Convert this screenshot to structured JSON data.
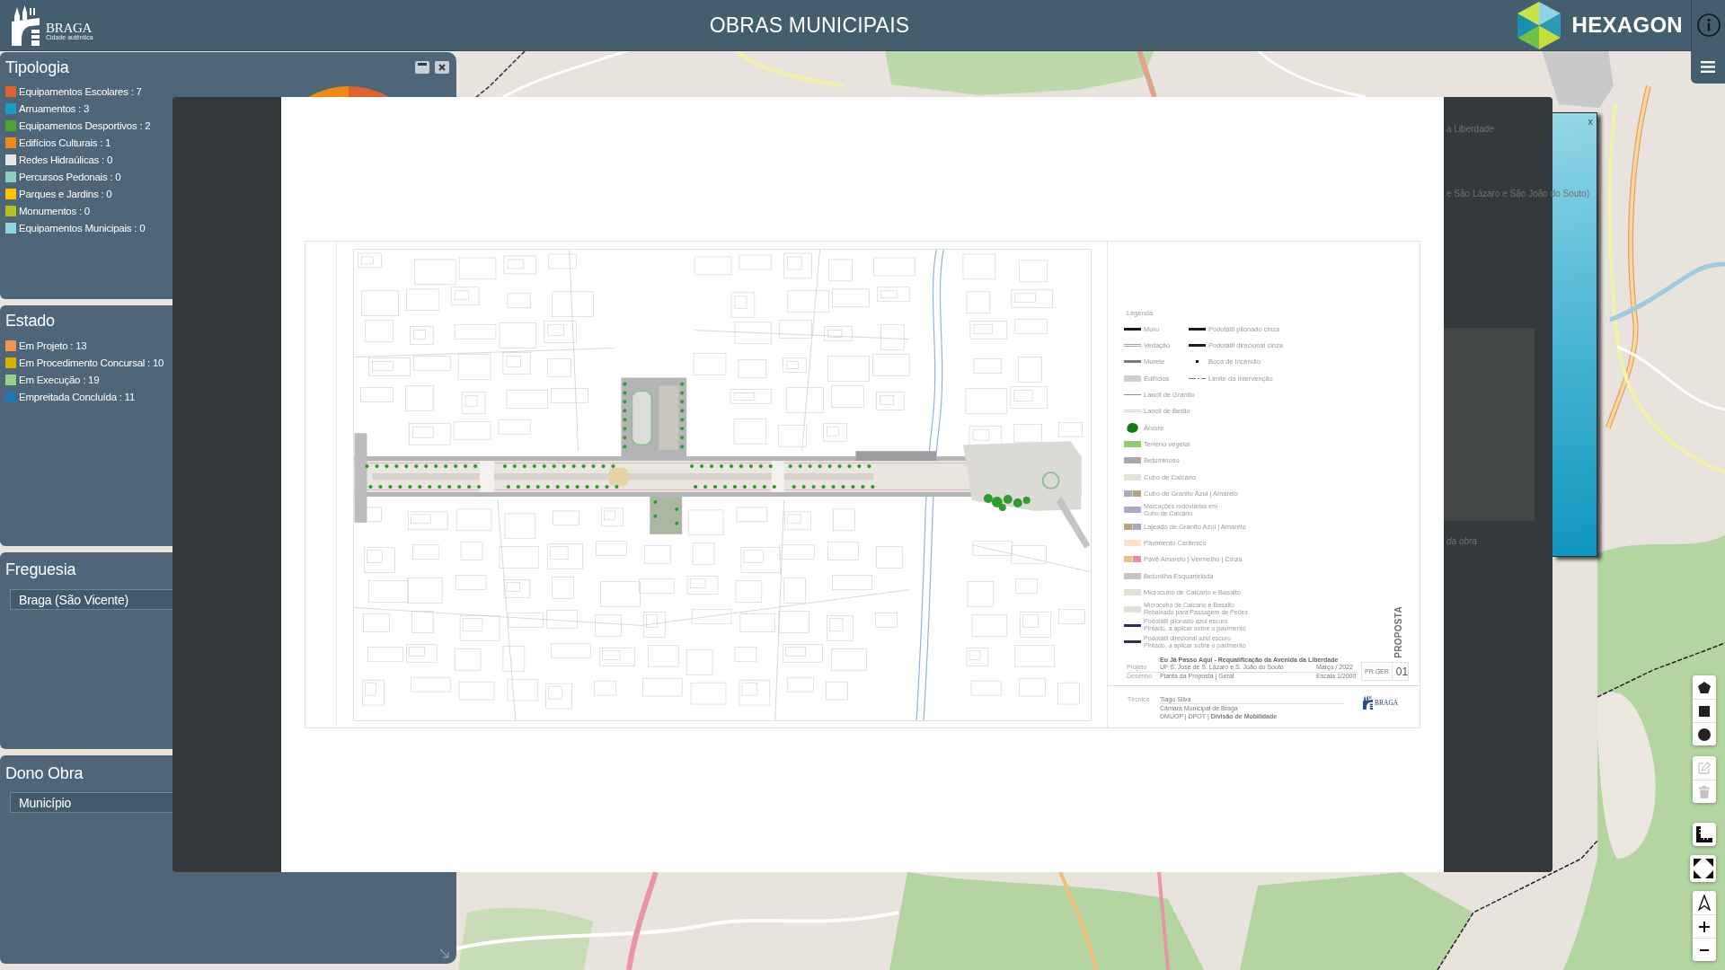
{
  "header": {
    "logo_name": "BRAGA",
    "logo_tagline": "Cidade autêntica",
    "title": "OBRAS MUNICIPAIS",
    "partner_name": "HEXAGON"
  },
  "filter_panels": [
    {
      "kind": "legend",
      "title": "Tipologia",
      "items": [
        {
          "label": "Equipamentos Escolares : 7",
          "color": "#e0622f"
        },
        {
          "label": "Arruamentos : 3",
          "color": "#1b9cc6"
        },
        {
          "label": "Equipamentos Desportivos : 2",
          "color": "#4fa330"
        },
        {
          "label": "Edifícios Culturais : 1",
          "color": "#f08a14"
        },
        {
          "label": "Redes Hidraúlicas : 0",
          "color": "#e6e6e6"
        },
        {
          "label": "Percursos Pedonais : 0",
          "color": "#8fcfc0"
        },
        {
          "label": "Parques e Jardins : 0",
          "color": "#f5c500"
        },
        {
          "label": "Monumentos : 0",
          "color": "#b6c21b"
        },
        {
          "label": "Equipamentos Municipais : 0",
          "color": "#8fd4e2"
        }
      ]
    },
    {
      "kind": "legend",
      "title": "Estado",
      "items": [
        {
          "label": "Em Projeto : 13",
          "color": "#f2964b"
        },
        {
          "label": "Em Procedimento Concursal : 10",
          "color": "#d6b300"
        },
        {
          "label": "Em Execução : 19",
          "color": "#99d18b"
        },
        {
          "label": "Empreitada Concluída : 11",
          "color": "#1f78b4"
        }
      ]
    },
    {
      "kind": "select",
      "title": "Freguesia",
      "value": "Braga (São Vicente)"
    },
    {
      "kind": "select",
      "title": "Dono Obra",
      "value": "Município"
    }
  ],
  "image_viewer": {
    "sheet": {
      "legend_title": "Legenda",
      "legend_columns": [
        {
          "items": [
            {
              "lines": [
                "Muro"
              ],
              "kind": "thick-line",
              "color": "#1a1a1a"
            },
            {
              "lines": [
                "Vedação"
              ],
              "kind": "double-line",
              "color": "#9a9a9a"
            },
            {
              "lines": [
                "Murete"
              ],
              "kind": "thick-line",
              "color": "#7a7a7a"
            },
            {
              "lines": [
                "Edifícios"
              ],
              "kind": "fill",
              "color": "#cfcfcf"
            },
            {
              "lines": [
                "Lancil de Granito"
              ],
              "kind": "thin-line",
              "color": "#8c8c8c"
            },
            {
              "lines": [
                "Lancil de Betão"
              ],
              "kind": "double-line",
              "color": "#cdcdcd"
            },
            {
              "lines": [
                "Árvore"
              ],
              "kind": "tree",
              "color": "#0e7d0e"
            },
            {
              "lines": [
                "Terreno vegetal"
              ],
              "kind": "fill",
              "color": "#8fcc74"
            },
            {
              "lines": [
                "Betuminoso"
              ],
              "kind": "fill",
              "color": "#a8a8aa"
            },
            {
              "lines": [
                "Cubo de Calcário"
              ],
              "kind": "fill",
              "color": "#e5e2da"
            },
            {
              "lines": [
                "Cubo de Granito Azul | Amarelo"
              ],
              "kind": "split-fill",
              "parts": [
                {
                  "color": "#a9abc3"
                },
                {
                  "color": "#b6a47c"
                }
              ]
            },
            {
              "lines": [
                "Marcações rodoviárias em",
                "Cubo de Calcário"
              ],
              "kind": "fill",
              "color": "#a9abc3"
            },
            {
              "lines": [
                "Lajeado de Granito Azul | Amarelo"
              ],
              "kind": "split-fill",
              "parts": [
                {
                  "color": "#b6a47c"
                },
                {
                  "color": "#a9abc3"
                }
              ]
            },
            {
              "lines": [
                "Pavimento Cerâmico"
              ],
              "kind": "fill",
              "color": "#fde1c9"
            },
            {
              "lines": [
                "Pavê Amarelo | Vermelho | Cinza"
              ],
              "kind": "split-fill",
              "parts": [
                {
                  "color": "#e8c27a"
                },
                {
                  "color": "#e48fa2"
                }
              ]
            },
            {
              "lines": [
                "Betonilha Esquartelada"
              ],
              "kind": "fill",
              "color": "#cac6bd"
            },
            {
              "lines": [
                "Microcubo de Calcário e Basalto"
              ],
              "kind": "fill",
              "color": "#e2dfd6"
            },
            {
              "lines": [
                "Microcubo de Calcário e Basalto",
                "Rebaixado para Passagem de Peões"
              ],
              "kind": "fill",
              "color": "#e2dfd6"
            },
            {
              "lines": [
                "Podotátil pilonado azul escuro",
                "Pintado, a aplicar sobre o pavimento"
              ],
              "kind": "thick-line",
              "color": "#2b2d66"
            },
            {
              "lines": [
                "Podotátil direcional azul escuro",
                "Pintado, a aplicar sobre o pavimento"
              ],
              "kind": "thick-line",
              "color": "#2b2d66"
            }
          ]
        },
        {
          "items": [
            {
              "lines": [
                "Podotátil pilonado cinza"
              ],
              "kind": "thick-line",
              "color": "#1c1c1c"
            },
            {
              "lines": [
                "Podotátil direcional cinza"
              ],
              "kind": "thick-line",
              "color": "#1c1c1c"
            },
            {
              "lines": [
                "Boca de Incêndio"
              ],
              "kind": "point",
              "color": "#1c1c1c"
            },
            {
              "lines": [
                "Limite da Intervenção"
              ],
              "kind": "dash-line",
              "color": "#777777"
            }
          ]
        }
      ],
      "stamp": "PROPOSTA",
      "project_title": "Eu Já Passo Aqui - Requalificação da Avenida da Liberdade",
      "title_rows": [
        {
          "label": "Projeto",
          "value": "UF S. José de S. Lázaro e S. João do Souto",
          "note": "Março / 2022"
        },
        {
          "label": "Desenho",
          "value": "Planta da Proposta | Geral",
          "note": "Escala 1/2000"
        }
      ],
      "sheet_code": "PR.GER",
      "sheet_number": "01",
      "credits_label": "Técnico",
      "credits": [
        "Tiago Silva",
        "Câmara Municipal de Braga",
        "DMUOP | DPOT | **Divisão de Mobilidade**"
      ],
      "logo_name": "BRAGA"
    }
  },
  "popup": {
    "line_1": "a Liberdade",
    "line_2": "e São Lázaro e São João do Souto)",
    "caption": "da obra",
    "close_label": "x"
  },
  "map_toolbar": {
    "draw_tools": [
      {
        "kind": "polygon",
        "disabled": false
      },
      {
        "kind": "rectangle",
        "disabled": false
      },
      {
        "kind": "circle",
        "disabled": false
      }
    ],
    "edit_tools": [
      {
        "kind": "edit",
        "disabled": true
      },
      {
        "kind": "delete",
        "disabled": true
      }
    ]
  }
}
